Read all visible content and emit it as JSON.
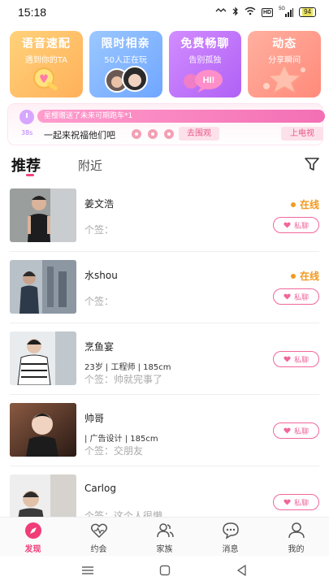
{
  "status_bar": {
    "time": "15:18",
    "hd_label": "HD",
    "network_label": "5G",
    "battery": "94"
  },
  "feature_cards": [
    {
      "title": "语音速配",
      "subtitle": "遇到你的TA"
    },
    {
      "title": "限时相亲",
      "subtitle": "50人正在玩"
    },
    {
      "title": "免费畅聊",
      "subtitle": "告别孤独",
      "bubble": "HI!"
    },
    {
      "title": "动态",
      "subtitle": "分享瞬间"
    }
  ],
  "notice": {
    "marquee": "星樱赠送了未来可期跑车*1",
    "countdown": "38s",
    "message": "一起来祝福他们吧",
    "watch_button": "去围观",
    "tv_button": "上电视"
  },
  "tabs": {
    "recommend": "推荐",
    "nearby": "附近"
  },
  "users": [
    {
      "name": "姜文浩",
      "info": "",
      "signature": "个签：",
      "status": "在线",
      "chat": "私聊"
    },
    {
      "name": "水shou",
      "info": "",
      "signature": "个签：",
      "status": "在线",
      "chat": "私聊"
    },
    {
      "name": "烹鱼宴",
      "info": "23岁 | 工程师 | 185cm",
      "signature": "个签：帅就完事了",
      "status": "",
      "chat": "私聊"
    },
    {
      "name": "帅哥",
      "info": "| 广告设计 | 185cm",
      "signature": "个签：交朋友",
      "status": "",
      "chat": "私聊"
    },
    {
      "name": "Carlog",
      "info": "",
      "signature": "个签：这个人很懒",
      "status": "",
      "chat": "私聊"
    }
  ],
  "bottom_nav": [
    {
      "label": "发现",
      "icon": "discover-icon",
      "active": true
    },
    {
      "label": "约会",
      "icon": "date-heart-icon",
      "active": false
    },
    {
      "label": "家族",
      "icon": "family-icon",
      "active": false
    },
    {
      "label": "消息",
      "icon": "message-icon",
      "active": false
    },
    {
      "label": "我的",
      "icon": "profile-icon",
      "active": false
    }
  ],
  "colors": {
    "accent": "#f03d78",
    "online": "#f29a1f",
    "chat_border": "#f0679b"
  }
}
